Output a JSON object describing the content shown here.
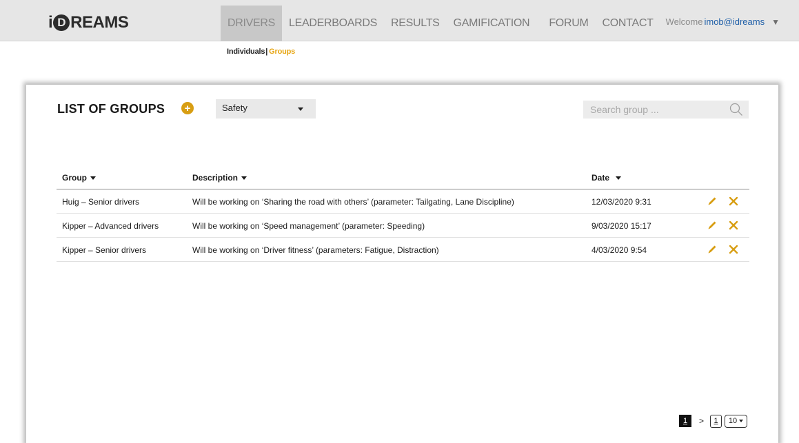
{
  "brand": {
    "logo_i": "i",
    "logo_d": "D",
    "logo_rest": "REAMS"
  },
  "nav": {
    "items": [
      {
        "label": "DRIVERS",
        "active": true
      },
      {
        "label": "LEADERBOARDS",
        "active": false
      },
      {
        "label": "RESULTS",
        "active": false
      },
      {
        "label": "GAMIFICATION",
        "active": false
      },
      {
        "label": "FORUM",
        "active": false
      },
      {
        "label": "CONTACT",
        "active": false
      }
    ],
    "welcome_prefix": "Welcome",
    "user": "imob@idreams",
    "user_caret": "▼"
  },
  "subnav": {
    "individuals": "Individuals",
    "separator": "|",
    "groups": "Groups",
    "active": "Groups"
  },
  "page": {
    "title": "LIST OF GROUPS",
    "add_icon": "plus-circle-icon",
    "add_symbol": "+",
    "category_select": {
      "value": "Safety"
    },
    "search": {
      "placeholder": "Search group ...",
      "value": "",
      "icon": "search-icon"
    }
  },
  "table": {
    "columns": [
      "Group",
      "Description",
      "Date"
    ],
    "rows": [
      {
        "group": "Huig – Senior drivers",
        "description": "Will be working on ‘Sharing the road with others’ (parameter: Tailgating, Lane Discipline)",
        "date": "12/03/2020 9:31"
      },
      {
        "group": "Kipper – Advanced drivers",
        "description": "Will be working on ‘Speed management’ (parameter: Speeding)",
        "date": "9/03/2020 15:17"
      },
      {
        "group": "Kipper – Senior drivers",
        "description": "Will be working on ‘Driver fitness’ (parameters: Fatigue, Distraction)",
        "date": "4/03/2020 9:54"
      }
    ],
    "row_actions": [
      "pencil-icon",
      "close-icon"
    ]
  },
  "pagination": {
    "current_page": "1",
    "next_symbol": ">",
    "last_page": "1",
    "page_size": "10"
  },
  "colors": {
    "accent": "#e7a614",
    "nav_bg": "#e6e6e6",
    "nav_active_bg": "#c8c8c8",
    "link": "#1f5fa8"
  }
}
